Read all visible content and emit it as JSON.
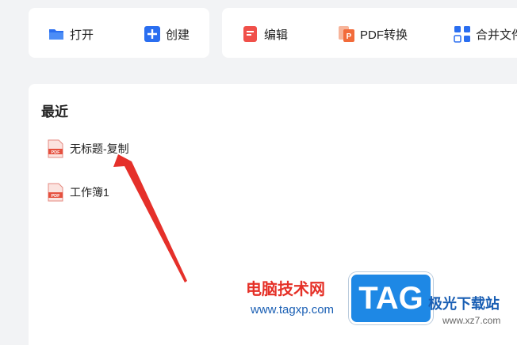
{
  "toolbar": {
    "open_label": "打开",
    "create_label": "创建",
    "edit_label": "编辑",
    "convert_label": "PDF转换",
    "merge_label": "合并文件"
  },
  "recent": {
    "title": "最近",
    "files": [
      {
        "name": "无标题-复制",
        "icon": "pdf-file-icon"
      },
      {
        "name": "工作簿1",
        "icon": "pdf-file-icon"
      }
    ]
  },
  "watermark": {
    "site_name": "电脑技术网",
    "site_url": "www.tagxp.com",
    "logo_text": "TAG",
    "site2_name": "极光下载站",
    "site2_url": "www.xz7.com"
  },
  "colors": {
    "accent_blue": "#2a6ef0",
    "edit_red": "#f0504a",
    "convert_orange": "#f26b3a",
    "arrow_red": "#e5302a",
    "tag_blue": "#1e88e5"
  }
}
